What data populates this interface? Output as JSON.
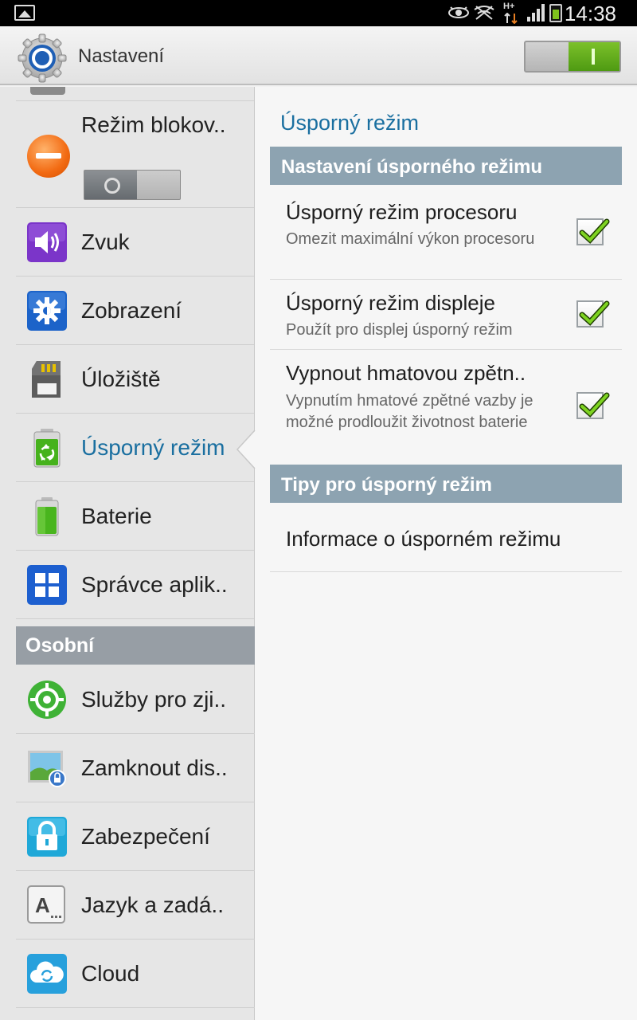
{
  "status_bar": {
    "time": "14:38",
    "network": "H+",
    "icons": [
      "picture-icon",
      "eye-icon",
      "no-signal-icon",
      "data-arrows-icon",
      "signal-icon",
      "battery-icon"
    ]
  },
  "action_bar": {
    "title": "Nastavení",
    "icon": "gear-icon",
    "master_switch_on": true
  },
  "sidebar": {
    "top_item": {
      "label": "Režim blokov..",
      "icon": "block-icon",
      "toggle_on": false
    },
    "items": [
      {
        "label": "Zvuk",
        "icon": "speaker-icon"
      },
      {
        "label": "Zobrazení",
        "icon": "display-gear-icon"
      },
      {
        "label": "Úložiště",
        "icon": "sd-card-icon"
      },
      {
        "label": "Úsporný režim",
        "icon": "recycle-battery-icon",
        "selected": true
      },
      {
        "label": "Baterie",
        "icon": "battery-icon"
      },
      {
        "label": "Správce aplik..",
        "icon": "apps-grid-icon"
      }
    ],
    "section_personal": "Osobní",
    "personal_items": [
      {
        "label": "Služby pro zji..",
        "icon": "location-icon"
      },
      {
        "label": "Zamknout dis..",
        "icon": "lock-screen-icon"
      },
      {
        "label": "Zabezpečení",
        "icon": "padlock-icon"
      },
      {
        "label": "Jazyk a zadá..",
        "icon": "keyboard-a-icon"
      },
      {
        "label": "Cloud",
        "icon": "cloud-sync-icon"
      }
    ]
  },
  "main": {
    "title": "Úsporný režim",
    "section1": "Nastavení úsporného režimu",
    "prefs": [
      {
        "title": "Úsporný režim procesoru",
        "summary": "Omezit maximální výkon procesoru",
        "checked": true
      },
      {
        "title": "Úsporný režim displeje",
        "summary": "Použít pro displej úsporný režim",
        "checked": true
      },
      {
        "title": "Vypnout hmatovou zpětn..",
        "summary": "Vypnutím hmatové zpětné vazby je možné prodloužit životnost baterie",
        "checked": true
      }
    ],
    "section2": "Tipy pro úsporný režim",
    "info_link": "Informace o úsporném režimu"
  },
  "colors": {
    "accent": "#1a6fa0",
    "section_header_left": "#979ea5",
    "section_header_right": "#8da3b1",
    "switch_on": "#6bb31f"
  }
}
